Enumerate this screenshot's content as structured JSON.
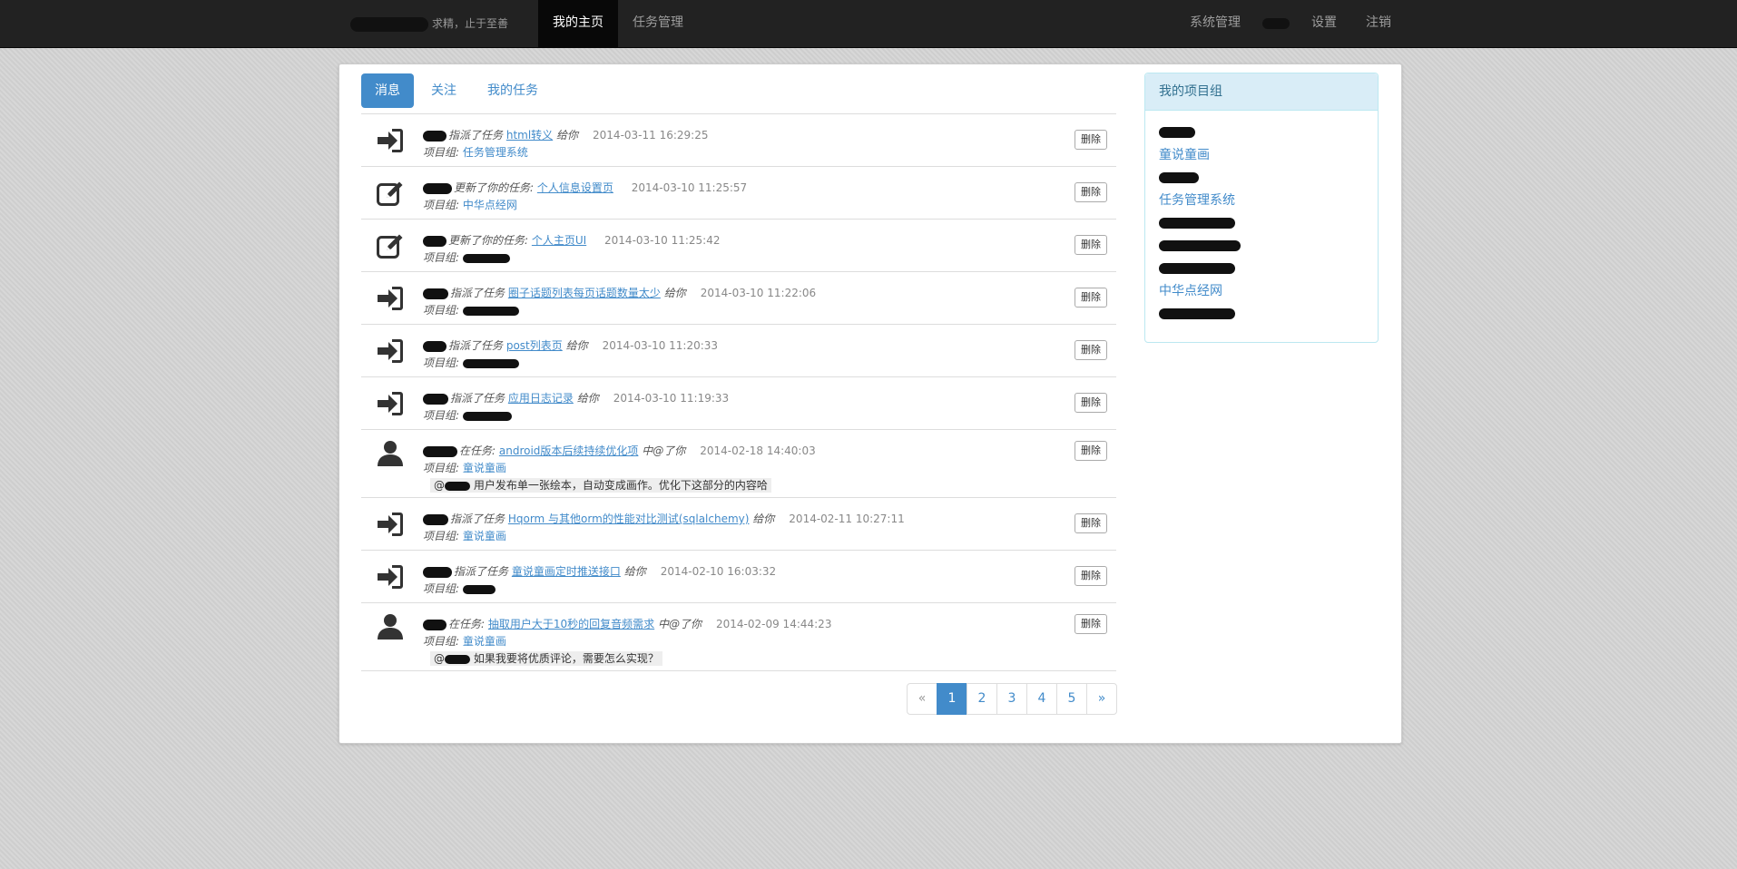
{
  "nav": {
    "brand_text": "求精，止于至善",
    "home": "我的主页",
    "tasks": "任务管理",
    "system": "系统管理",
    "settings": "设置",
    "logout": "注销"
  },
  "tabs": [
    "消息",
    "关注",
    "我的任务"
  ],
  "delete_label": "删除",
  "project_label": "项目组:",
  "messages": [
    {
      "icon": "sign-in-icon",
      "action": "指派了任务",
      "task": "html转义",
      "suffix": "给你",
      "time": "2014-03-11 16:29:25",
      "project": "任务管理系统",
      "quote": ""
    },
    {
      "icon": "edit-icon",
      "action": "更新了你的任务:",
      "task": "个人信息设置页",
      "suffix": "",
      "time": "2014-03-10 11:25:57",
      "project": "中华点经网",
      "quote": ""
    },
    {
      "icon": "edit-icon",
      "action": "更新了你的任务:",
      "task": "个人主页UI",
      "suffix": "",
      "time": "2014-03-10 11:25:42",
      "project": "",
      "quote": ""
    },
    {
      "icon": "sign-in-icon",
      "action": "指派了任务",
      "task": "圈子话题列表每页话题数量太少",
      "suffix": "给你",
      "time": "2014-03-10 11:22:06",
      "project": "",
      "quote": ""
    },
    {
      "icon": "sign-in-icon",
      "action": "指派了任务",
      "task": "post列表页",
      "suffix": "给你",
      "time": "2014-03-10 11:20:33",
      "project": "",
      "quote": ""
    },
    {
      "icon": "sign-in-icon",
      "action": "指派了任务",
      "task": "应用日志记录",
      "suffix": "给你",
      "time": "2014-03-10 11:19:33",
      "project": "",
      "quote": ""
    },
    {
      "icon": "user-icon",
      "action": "在任务:",
      "task": "android版本后续持续优化项",
      "suffix": "中@了你",
      "time": "2014-02-18 14:40:03",
      "project": "童说童画",
      "quote": "用户发布单一张绘本，自动变成画作。优化下这部分的内容哈"
    },
    {
      "icon": "sign-in-icon",
      "action": "指派了任务",
      "task": "Hqorm 与其他orm的性能对比测试(sqlalchemy)",
      "suffix": "给你",
      "time": "2014-02-11 10:27:11",
      "project": "童说童画",
      "quote": ""
    },
    {
      "icon": "sign-in-icon",
      "action": "指派了任务",
      "task": "童说童画定时推送接口",
      "suffix": "给你",
      "time": "2014-02-10 16:03:32",
      "project": "",
      "quote": ""
    },
    {
      "icon": "user-icon",
      "action": "在任务:",
      "task": "抽取用户大于10秒的回复音频需求",
      "suffix": "中@了你",
      "time": "2014-02-09 14:44:23",
      "project": "童说童画",
      "quote": "如果我要将优质评论，需要怎么实现？"
    }
  ],
  "pagination": [
    "«",
    "1",
    "2",
    "3",
    "4",
    "5",
    "»"
  ],
  "sidebar": {
    "title": "我的项目组",
    "items": [
      "",
      "童说童画",
      "",
      "任务管理系统",
      "",
      "",
      "",
      "中华点经网",
      ""
    ]
  }
}
